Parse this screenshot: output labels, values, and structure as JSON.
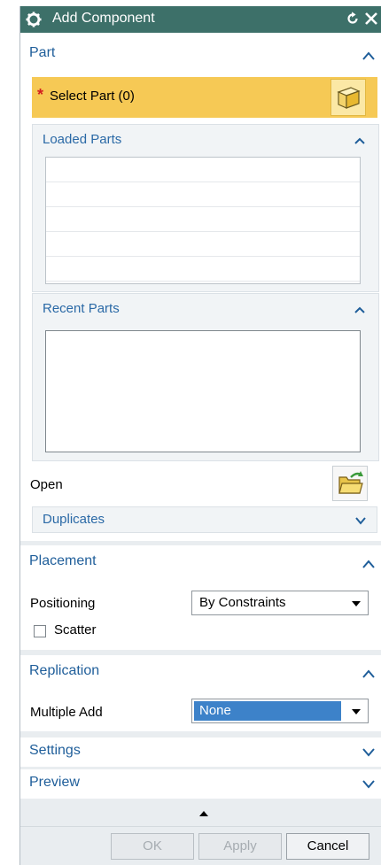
{
  "window": {
    "title": "Add Component"
  },
  "part": {
    "group_title": "Part",
    "select_part_label": "Select Part (0)",
    "required_marker": "*",
    "loaded_parts": {
      "title": "Loaded Parts",
      "rows": [
        "",
        "",
        "",
        "",
        ""
      ]
    },
    "recent_parts": {
      "title": "Recent Parts"
    },
    "open_label": "Open",
    "duplicates_title": "Duplicates"
  },
  "placement": {
    "group_title": "Placement",
    "positioning_label": "Positioning",
    "positioning_value": "By Constraints",
    "scatter_label": "Scatter",
    "scatter_checked": false
  },
  "replication": {
    "group_title": "Replication",
    "multiple_add_label": "Multiple Add",
    "multiple_add_value": "None"
  },
  "settings": {
    "group_title": "Settings"
  },
  "preview": {
    "group_title": "Preview"
  },
  "buttons": {
    "ok": "OK",
    "apply": "Apply",
    "cancel": "Cancel"
  },
  "colors": {
    "titlebar": "#3d7069",
    "group_title": "#1f5e9a",
    "selection_highlight": "#f6c955",
    "required": "#d21f1f",
    "dropdown_selected": "#3d82c9"
  },
  "icons": [
    "gear-icon",
    "reset-icon",
    "close-icon",
    "collapse-chevron-icon",
    "expand-chevron-icon",
    "part-cube-icon",
    "open-folder-icon",
    "dropdown-arrow-icon",
    "more-options-triangle-icon"
  ]
}
